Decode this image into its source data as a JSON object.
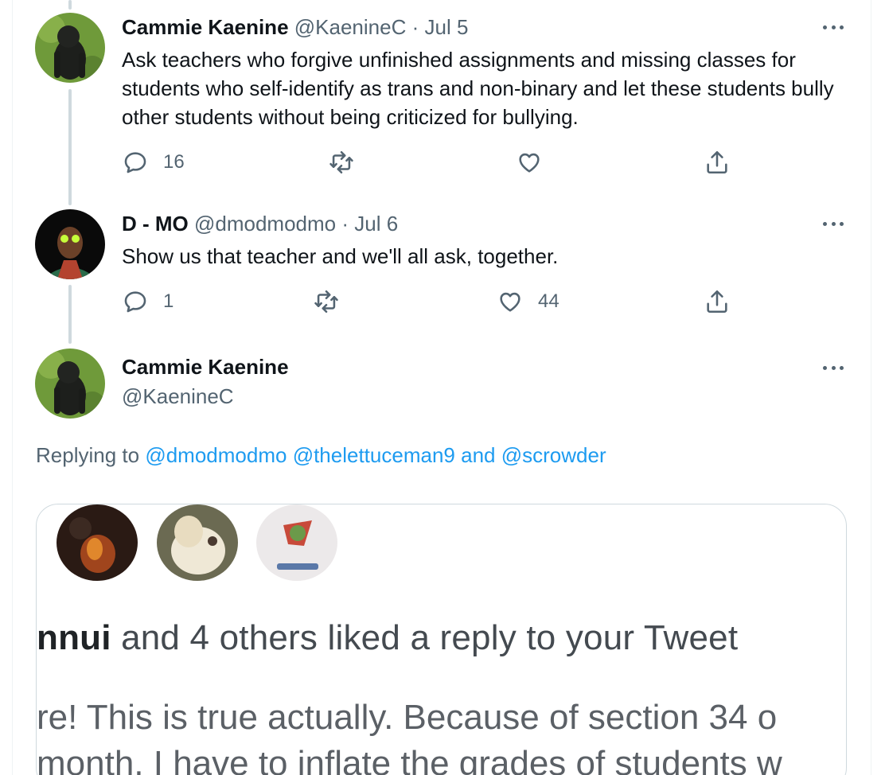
{
  "tweets": [
    {
      "name": "Cammie Kaenine",
      "handle": "@KaenineC",
      "date": "Jul 5",
      "separator": "·",
      "text": "Ask teachers who forgive unfinished assignments and missing classes for students who self-identify as trans and non-binary and let these students bully other students without being criticized for bullying.",
      "reply_count": "16",
      "retweet_count": "",
      "like_count": "",
      "avatar_icon": "gorilla-avatar"
    },
    {
      "name": "D - MO",
      "handle": "@dmodmodmo",
      "date": "Jul 6",
      "separator": "·",
      "text": "Show us that teacher and we'll all ask, together.",
      "reply_count": "1",
      "retweet_count": "",
      "like_count": "44",
      "avatar_icon": "basketball-player-avatar"
    }
  ],
  "main_tweet": {
    "name": "Cammie Kaenine",
    "handle": "@KaenineC",
    "replying_prefix": "Replying to",
    "mentions": [
      "@dmodmodmo",
      "@thelettuceman9"
    ],
    "conjunction": "and",
    "last_mention": "@scrowder",
    "media": {
      "notif_bold": "nnui",
      "notif_rest": " and 4 others liked a reply to your Tweet",
      "line1": "re! This is true actually. Because of section 34 o",
      "line2": "month, I have to inflate the grades of students w"
    }
  },
  "colors": {
    "link": "#1d9bf0",
    "secondary_text": "#536471",
    "thread_line": "#cfd9de"
  }
}
